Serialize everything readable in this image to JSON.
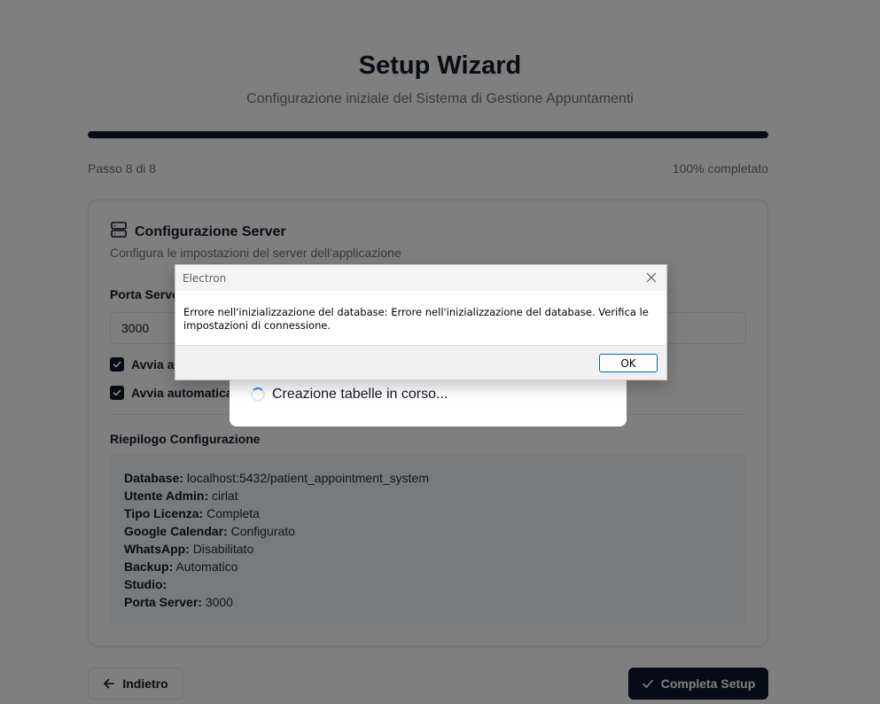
{
  "wizard": {
    "title": "Setup Wizard",
    "subtitle": "Configurazione iniziale del Sistema di Gestione Appuntamenti",
    "step_text": "Passo 8 di 8",
    "percent_text": "100% completato",
    "progress_fraction": 1.0
  },
  "card": {
    "title": "Configurazione Server",
    "description": "Configura le impostazioni del server dell'applicazione",
    "port_label": "Porta Server",
    "port_value": "3000",
    "checkbox1_label": "Avvia au",
    "checkbox2_label": "Avvia automatica",
    "summary_title": "Riepilogo Configurazione",
    "summary": [
      {
        "key": "Database:",
        "value": "localhost:5432/patient_appointment_system"
      },
      {
        "key": "Utente Admin:",
        "value": "cirlat"
      },
      {
        "key": "Tipo Licenza:",
        "value": "Completa"
      },
      {
        "key": "Google Calendar:",
        "value": "Configurato"
      },
      {
        "key": "WhatsApp:",
        "value": "Disabilitato"
      },
      {
        "key": "Backup:",
        "value": "Automatico"
      },
      {
        "key": "Studio:",
        "value": ""
      },
      {
        "key": "Porta Server:",
        "value": "3000"
      }
    ]
  },
  "footer": {
    "back_label": "Indietro",
    "complete_label": "Completa Setup"
  },
  "loading": {
    "text": "Creazione tabelle in corso..."
  },
  "dialog": {
    "title": "Electron",
    "message": "Errore nell'inizializzazione del database: Errore nell'inizializzazione del database. Verifica le impostazioni di connessione.",
    "ok_label": "OK"
  },
  "colors": {
    "primary": "#0f172a",
    "muted_text": "#6b7280",
    "summary_bg": "#f3f4f6",
    "spinner": "#3b82f6",
    "dialog_button_border": "#0067c0"
  },
  "icons": {
    "card_header": "server-icon",
    "checkbox": "check-icon",
    "back": "arrow-left-icon",
    "complete": "check-icon",
    "dialog_close": "close-icon"
  }
}
